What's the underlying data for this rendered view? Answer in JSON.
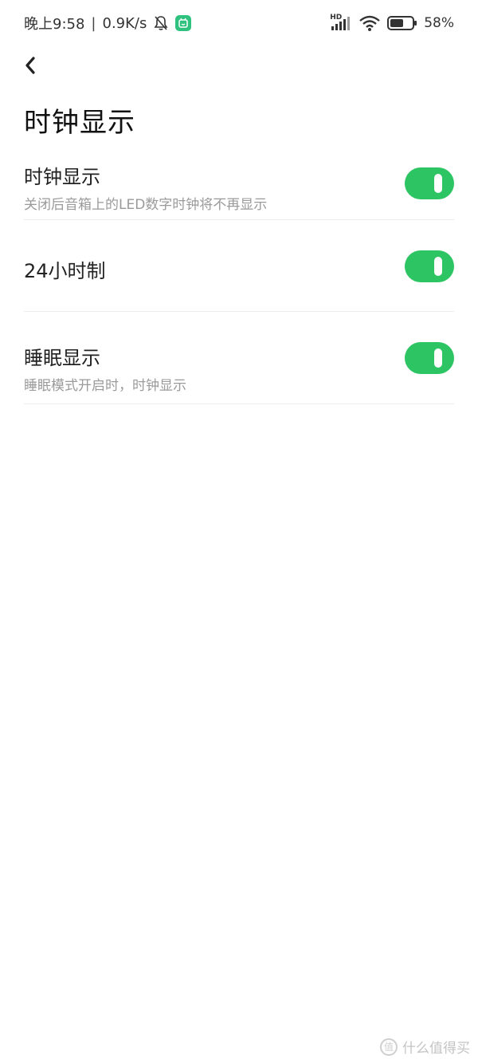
{
  "status_bar": {
    "time": "晚上9:58",
    "separator": "|",
    "net_speed": "0.9K/s",
    "hd_label": "HD",
    "battery_percent": "58%",
    "icons": [
      "mute-bell-icon",
      "mi-home-icon",
      "signal-icon",
      "wifi-icon",
      "battery-icon"
    ],
    "mi_icon_color": "#2ec27e"
  },
  "header": {
    "back_icon": "chevron-left-icon",
    "title": "时钟显示"
  },
  "settings": {
    "items": [
      {
        "title": "时钟显示",
        "subtitle": "关闭后音箱上的LED数字时钟将不再显示",
        "enabled": true
      },
      {
        "title": "24小时制",
        "subtitle": "",
        "enabled": true
      },
      {
        "title": "睡眠显示",
        "subtitle": "睡眠模式开启时，时钟显示",
        "enabled": true
      }
    ],
    "toggle_on_color": "#2dc463"
  },
  "watermark": {
    "logo_char": "值",
    "text": "什么值得买"
  }
}
